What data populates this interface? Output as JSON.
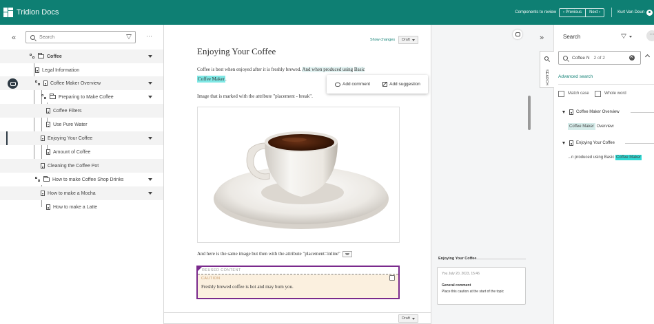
{
  "header": {
    "app_name": "Tridion Docs",
    "review_label": "Components to review",
    "previous_label": "Previous",
    "next_label": "Next",
    "user_name": "Kurt Van Deun"
  },
  "left_pane": {
    "search_placeholder": "Search",
    "more": "···",
    "collapse": "«",
    "tree": [
      {
        "label": "Coffee"
      },
      {
        "label": "Legal Information"
      },
      {
        "label": "Coffee Maker Overview"
      },
      {
        "label": "Preparing to Make Coffee"
      },
      {
        "label": "Coffee Filters"
      },
      {
        "label": "Use Pure Water"
      },
      {
        "label": "Enjoying Your Coffee"
      },
      {
        "label": "Amount of Coffee"
      },
      {
        "label": "Cleaning the Coffee Pot"
      },
      {
        "label": "How to make Coffee Shop Drinks"
      },
      {
        "label": "How to make a Mocha"
      },
      {
        "label": "How to make a Latte"
      }
    ]
  },
  "editor": {
    "show_changes": "Show changes",
    "status": "Draft",
    "title": "Enjoying Your Coffee",
    "para1_a": "Coffee is best when enjoyed after it is freshly brewed.",
    "para1_b": "And when produced using",
    "para1_c": "Basic",
    "para1_d": "Coffee Maker",
    "para1_e": ".",
    "para2": "Image that is marked with the attribute \"placement - break\".",
    "para3": "And here is the same image but then with the attribute \"placement=inline\"",
    "reused_label": "REUSED CONTENT",
    "caution_label": "CAUTION",
    "caution_text": "Freshly brewed coffee is hot and may burn you.",
    "footer_status": "Draft",
    "popover": {
      "add_comment": "Add comment",
      "add_suggestion": "Add suggestion"
    }
  },
  "comments": {
    "section_title": "Enjoying Your Coffee",
    "card": {
      "meta": "You  July 20, 2023, 15:46",
      "title": "General comment",
      "text": "Place this caution at the start of the topic"
    }
  },
  "search_panel": {
    "collapse": "»",
    "tab_label": "SEARCH",
    "title": "Search",
    "more": "···",
    "query": "Coffee N",
    "count": "2 of 2",
    "advanced": "Advanced search",
    "match_case": "Match case",
    "whole_word": "Whole word",
    "results": [
      {
        "title": "Coffee Maker Overview",
        "hit": "Coffee Maker",
        "rest": " Overview"
      },
      {
        "title": "Enjoying Your Coffee",
        "pre": "...n produced using Basic ",
        "hit": "Coffee Maker"
      }
    ]
  },
  "colors": {
    "header": "#0e7f73",
    "reused_border": "#7a2a8c",
    "highlight": "#7fe8e5"
  }
}
